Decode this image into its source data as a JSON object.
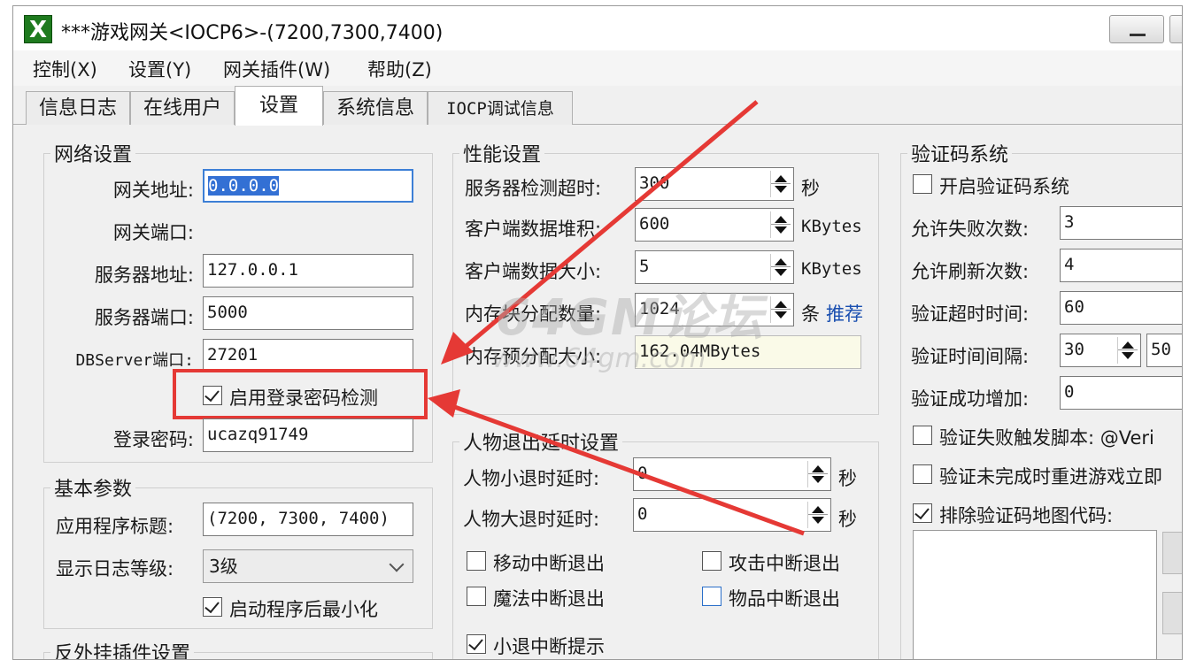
{
  "window": {
    "title": "***游戏网关<IOCP6>-(7200,7300,7400)",
    "icon_letter": "X"
  },
  "menu": [
    "控制(X)",
    "设置(Y)",
    "网关插件(W)",
    "帮助(Z)"
  ],
  "tabs": [
    "信息日志",
    "在线用户",
    "设置",
    "系统信息",
    "IOCP调试信息"
  ],
  "network": {
    "title": "网络设置",
    "gateway_address_label": "网关地址:",
    "gateway_address": "0.0.0.0",
    "gateway_port_label": "网关端口:",
    "server_address_label": "服务器地址:",
    "server_address": "127.0.0.1",
    "server_port_label": "服务器端口:",
    "server_port": "5000",
    "dbserver_port_label": "DBServer端口:",
    "dbserver_port": "27201",
    "enable_password_check": "启用登录密码检测",
    "login_password_label": "登录密码:",
    "login_password": "ucazq91749"
  },
  "basic": {
    "title": "基本参数",
    "app_title_label": "应用程序标题:",
    "app_title": "(7200, 7300, 7400)",
    "log_level_label": "显示日志等级:",
    "log_level": "3级",
    "minimize_label": "启动程序后最小化"
  },
  "anti_cheat": {
    "title": "反外挂插件设置"
  },
  "performance": {
    "title": "性能设置",
    "server_timeout_label": "服务器检测超时:",
    "server_timeout": "300",
    "server_timeout_unit": "秒",
    "client_backlog_label": "客户端数据堆积:",
    "client_backlog": "600",
    "client_backlog_unit": "KBytes",
    "client_size_label": "客户端数据大小:",
    "client_size": "5",
    "client_size_unit": "KBytes",
    "mem_blocks_label": "内存块分配数量:",
    "mem_blocks": "1024",
    "mem_blocks_unit": "条",
    "recommend": "推荐",
    "mem_alloc_label": "内存预分配大小:",
    "mem_alloc": "162.04MBytes"
  },
  "exit_delay": {
    "title": "人物退出延时设置",
    "small_exit_label": "人物小退时延时:",
    "small_exit": "0",
    "small_exit_unit": "秒",
    "big_exit_label": "人物大退时延时:",
    "big_exit": "0",
    "big_exit_unit": "秒",
    "move_interrupt": "移动中断退出",
    "attack_interrupt": "攻击中断退出",
    "magic_interrupt": "魔法中断退出",
    "item_interrupt": "物品中断退出",
    "small_exit_prompt": "小退中断提示"
  },
  "captcha": {
    "title": "验证码系统",
    "enable": "开启验证码系统",
    "fail_count_label": "允许失败次数:",
    "fail_count": "3",
    "refresh_count_label": "允许刷新次数:",
    "refresh_count": "4",
    "timeout_label": "验证超时时间:",
    "timeout": "60",
    "interval_label": "验证时间间隔:",
    "interval_a": "30",
    "interval_b": "50",
    "success_add_label": "验证成功增加:",
    "success_add": "0",
    "fail_script": "验证失败触发脚本: @Veri",
    "incomplete_reenter": "验证未完成时重进游戏立即",
    "exclude_map": "排除验证码地图代码:"
  },
  "watermark": {
    "main": "64GM论坛",
    "url": "www.64gm.com"
  },
  "colors": {
    "highlight": "#e53935",
    "accent": "#3370d4"
  }
}
